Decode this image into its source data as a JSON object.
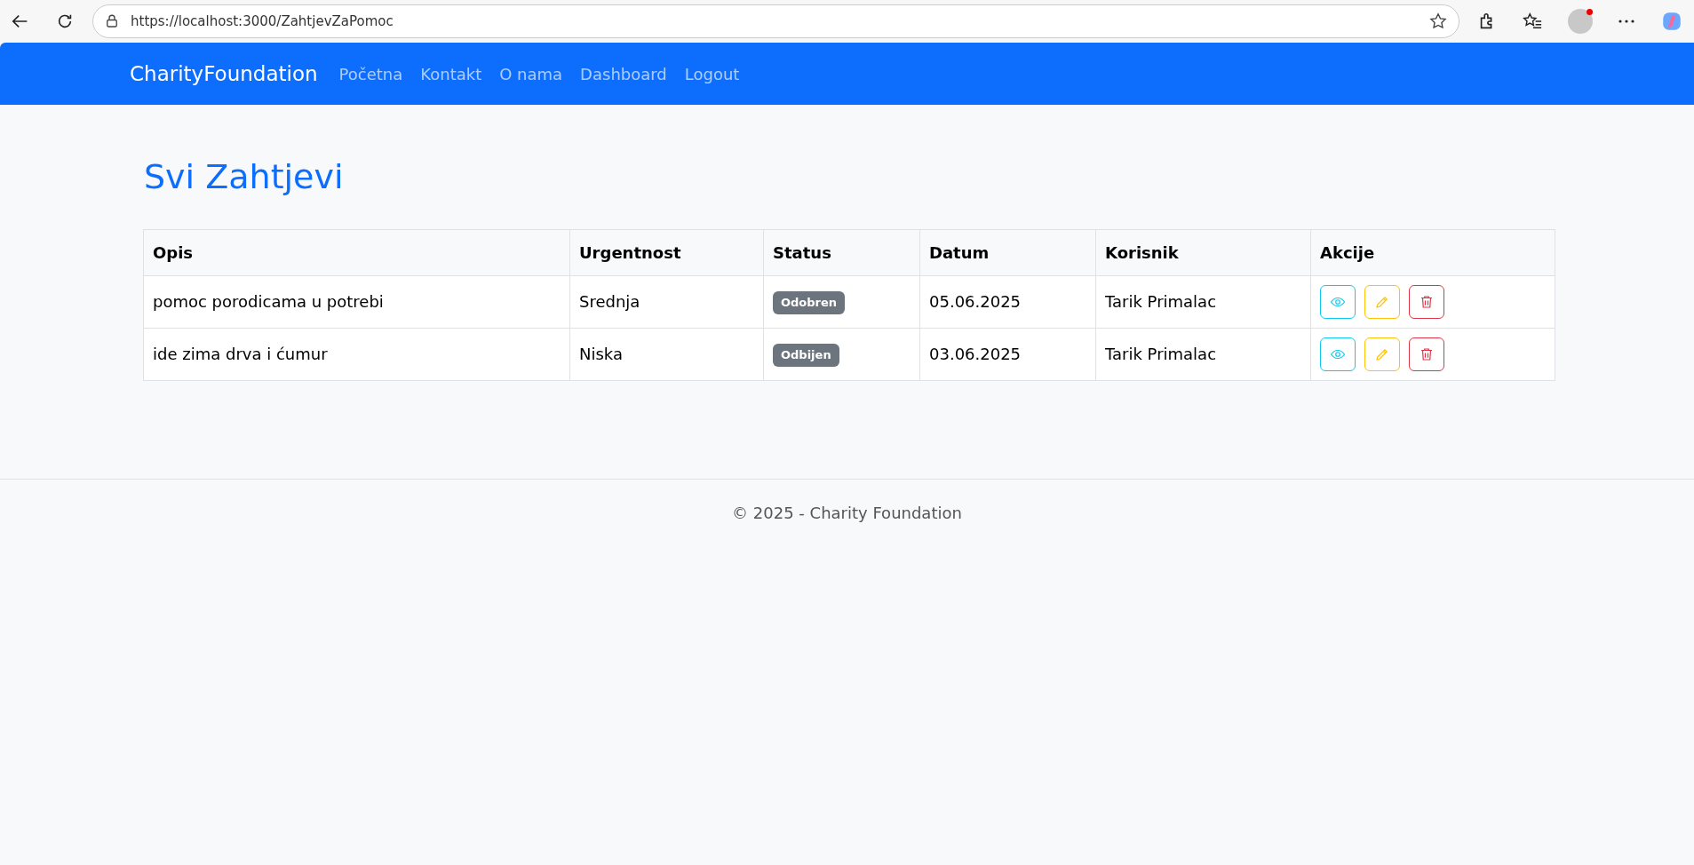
{
  "browser": {
    "url": "https://localhost:3000/ZahtjevZaPomoc"
  },
  "navbar": {
    "brand": "CharityFoundation",
    "links": [
      {
        "label": "Početna"
      },
      {
        "label": "Kontakt"
      },
      {
        "label": "O nama"
      },
      {
        "label": "Dashboard"
      },
      {
        "label": "Logout"
      }
    ]
  },
  "page_title": "Svi Zahtjevi",
  "table": {
    "columns": [
      "Opis",
      "Urgentnost",
      "Status",
      "Datum",
      "Korisnik",
      "Akcije"
    ],
    "rows": [
      {
        "opis": "pomoc porodicama u potrebi",
        "urgentnost": "Srednja",
        "status": "Odobren",
        "datum": "05.06.2025",
        "korisnik": "Tarik Primalac"
      },
      {
        "opis": "ide zima drva i ćumur",
        "urgentnost": "Niska",
        "status": "Odbijen",
        "datum": "03.06.2025",
        "korisnik": "Tarik Primalac"
      }
    ]
  },
  "footer": {
    "text": "© 2025 - Charity Foundation"
  }
}
